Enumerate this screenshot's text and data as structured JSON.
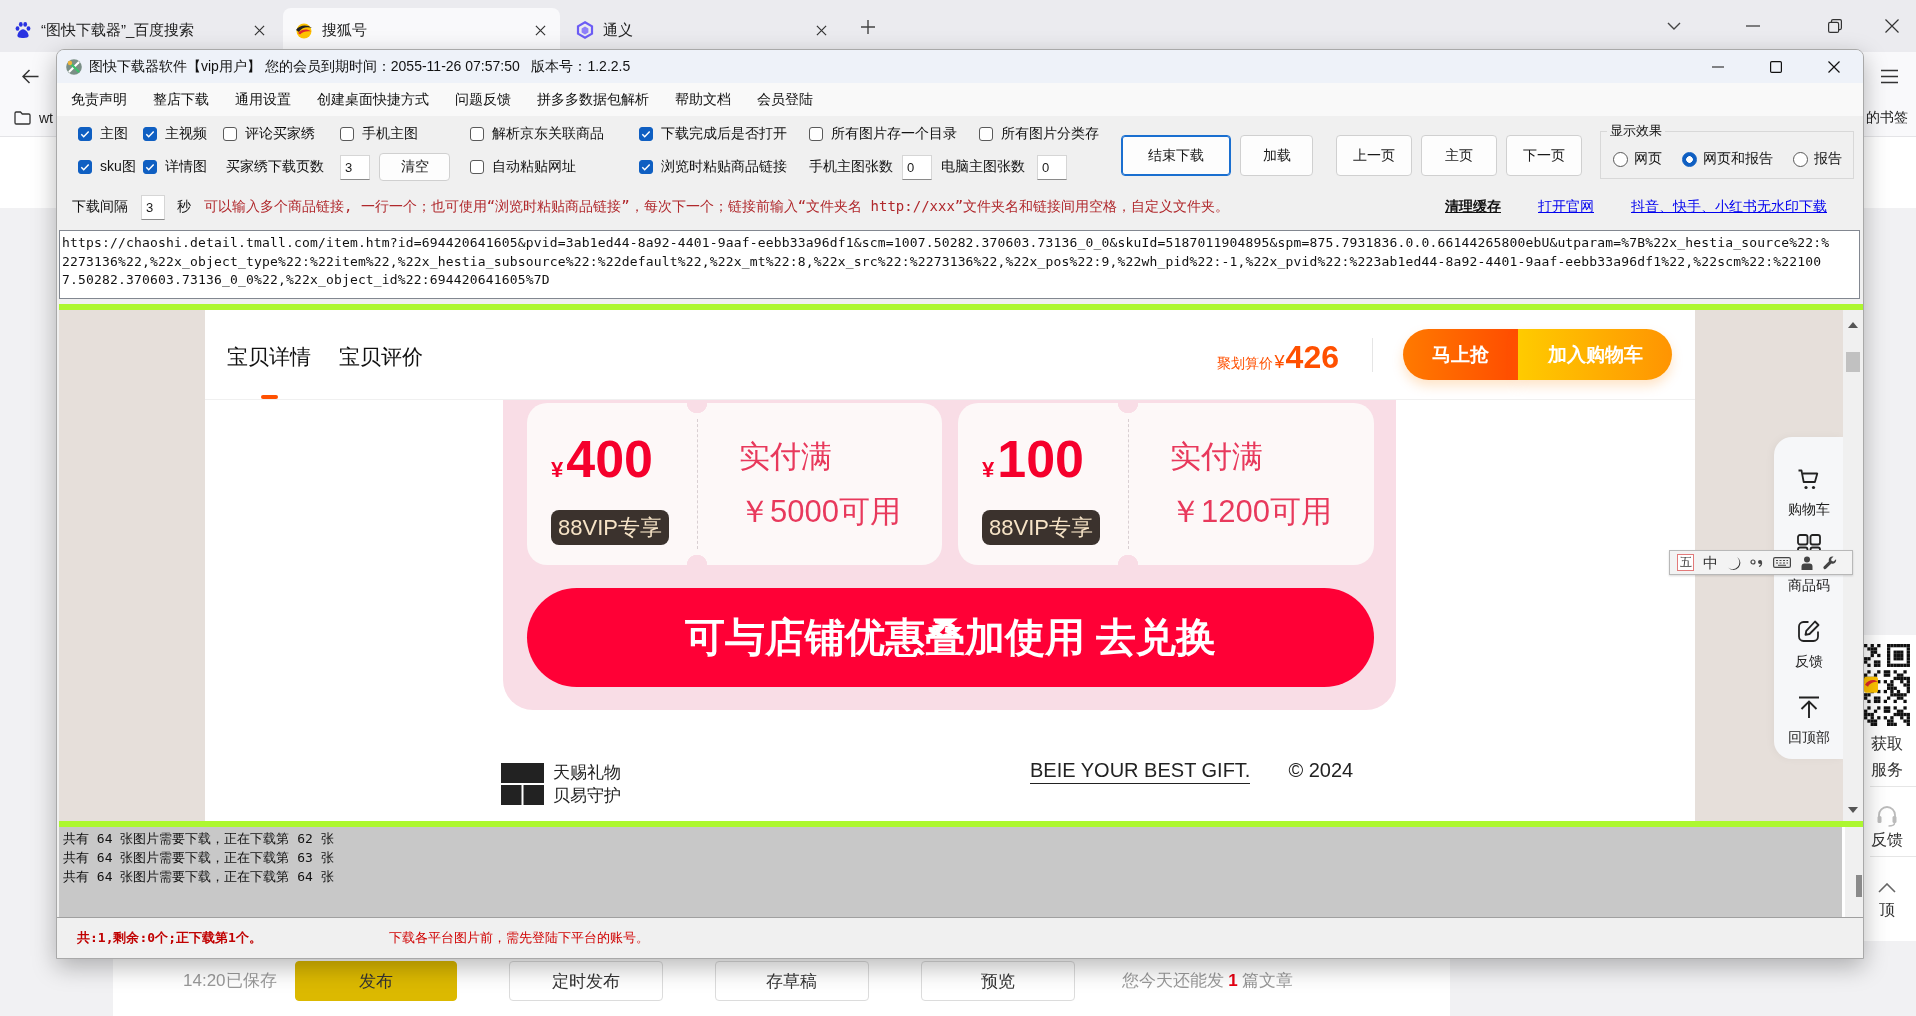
{
  "browser": {
    "tabs": [
      {
        "title": "“图快下载器”_百度搜索",
        "selected": false
      },
      {
        "title": "搜狐号",
        "selected": true
      },
      {
        "title": "通义",
        "selected": false
      }
    ],
    "bookmarks": {
      "left": "wt",
      "right": "的书签"
    }
  },
  "page_behind": {
    "side_panel": {
      "qr_caption": [
        "获取",
        "服务"
      ],
      "items": [
        {
          "label": "反馈"
        },
        {
          "label": "顶"
        }
      ]
    },
    "editor_bar": {
      "save_status": "14:20已保存",
      "buttons": [
        {
          "label": "发布",
          "kind": "primary"
        },
        {
          "label": "定时发布",
          "kind": "default"
        },
        {
          "label": "存草稿",
          "kind": "default"
        },
        {
          "label": "预览",
          "kind": "default"
        }
      ],
      "quota": "您今天还能发 **1** 篇文章"
    }
  },
  "app": {
    "title": "图快下载器软件【vip用户】 您的会员到期时间：2055-11-26 07:57:50   版本号：1.2.2.5",
    "menu": [
      "免责声明",
      "整店下载",
      "通用设置",
      "创建桌面快捷方式",
      "问题反馈",
      "拼多多数据包解析",
      "帮助文档",
      "会员登陆"
    ],
    "options": {
      "rows": [
        [
          {
            "kind": "checkbox",
            "label": "主图",
            "checked": true
          },
          {
            "kind": "checkbox",
            "label": "主视频",
            "checked": true
          },
          {
            "kind": "checkbox",
            "label": "评论买家绣",
            "checked": false
          },
          {
            "kind": "checkbox",
            "label": "手机主图",
            "checked": false
          },
          {
            "kind": "checkbox",
            "label": "解析京东关联商品",
            "checked": false
          },
          {
            "kind": "checkbox",
            "label": "下载完成后是否打开",
            "checked": true
          },
          {
            "kind": "checkbox",
            "label": "所有图片存一个目录",
            "checked": false
          },
          {
            "kind": "checkbox",
            "label": "所有图片分类存",
            "checked": false
          }
        ],
        [
          {
            "kind": "checkbox",
            "label": "sku图",
            "checked": true
          },
          {
            "kind": "checkbox",
            "label": "详情图",
            "checked": true
          },
          {
            "kind": "number",
            "label": "买家绣下载页数",
            "value": "3"
          },
          {
            "kind": "button",
            "label": "清空"
          },
          {
            "kind": "checkbox",
            "label": "自动粘贴网址",
            "checked": false
          },
          {
            "kind": "checkbox",
            "label": "浏览时粘贴商品链接",
            "checked": true
          },
          {
            "kind": "number",
            "label": "手机主图张数",
            "value": "0"
          },
          {
            "kind": "number",
            "label": "电脑主图张数",
            "value": "0"
          }
        ]
      ],
      "action_buttons": [
        {
          "label": "结束下载",
          "focused": true
        },
        {
          "label": "加载",
          "focused": false
        }
      ],
      "nav_buttons": [
        {
          "label": "上一页"
        },
        {
          "label": "主页"
        },
        {
          "label": "下一页"
        }
      ],
      "display": {
        "title": "显示效果",
        "options": [
          {
            "label": "网页",
            "selected": false
          },
          {
            "label": "网页和报告",
            "selected": true
          },
          {
            "label": "报告",
            "selected": false
          }
        ]
      }
    },
    "settings_row": {
      "interval_label": "下载间隔",
      "interval_value": "3",
      "interval_unit": "秒",
      "hint": "可以输入多个商品链接, 一行一个；也可使用“浏览时粘贴商品链接”，每次下一个；链接前输入“文件夹名 http://xxx”文件夹名和链接间用空格，自定义文件夹。",
      "links": [
        {
          "label": "清理缓存",
          "kind": "action"
        },
        {
          "label": "打开官网",
          "kind": "link"
        },
        {
          "label": "抖音、快手、小红书无水印下载",
          "kind": "link"
        }
      ]
    },
    "url_field": {
      "value": "https://chaoshi.detail.tmall.com/item.htm?id=694420641605&pvid=3ab1ed44-8a92-4401-9aaf-eebb33a96df1&scm=1007.50282.370603.73136_0_0&skuId=5187011904895&spm=875.7931836.0.0.66144265800ebU&utparam=%7B%22x_hestia_source%22:%2273136%22,%22x_object_type%22:%22item%22,%22x_hestia_subsource%22:%22default%22,%22x_mt%22:8,%22x_src%22:%2273136%22,%22x_pos%22:9,%22wh_pid%22:-1,%22x_pvid%22:%223ab1ed44-8a92-4401-9aaf-eebb33a96df1%22,%22scm%22:%221007.50282.370603.73136_0_0%22,%22x_object_id%22:694420641605%7D"
    },
    "webpage": {
      "tabs": [
        {
          "label": "宝贝详情",
          "selected": true
        },
        {
          "label": "宝贝评价",
          "selected": false
        }
      ],
      "price_label": "聚划算价",
      "price_currency": "¥",
      "price_value": "426",
      "buy_buttons": [
        {
          "label": "马上抢"
        },
        {
          "label": "加入购物车"
        }
      ],
      "coupons": [
        {
          "currency": "¥",
          "amount": "400",
          "badge": "88VIP专享",
          "condition": "实付满",
          "threshold": "￥5000可用"
        },
        {
          "currency": "¥",
          "amount": "100",
          "badge": "88VIP专享",
          "condition": "实付满",
          "threshold": "￥1200可用"
        }
      ],
      "coupon_action": "可与店铺优惠叠加使用 去兑换",
      "footer": {
        "brand_lines": [
          "天赐礼物",
          "贝易守护"
        ],
        "slogan": "BEIE YOUR BEST GIFT.",
        "copyright": "© 2024"
      },
      "side_tools": [
        {
          "label": "购物车"
        },
        {
          "label": "商品码"
        },
        {
          "label": "反馈"
        },
        {
          "label": "回顶部"
        }
      ]
    },
    "ime_toolbar": {
      "mode": "五",
      "language": "中"
    },
    "log": {
      "lines": [
        "共有 64 张图片需要下载，正在下载第 62 张",
        "共有 64 张图片需要下载，正在下载第 63 张",
        "共有 64 张图片需要下载，正在下载第 64 张"
      ]
    },
    "status_bar": {
      "progress": "共:1,剩余:0个;正下载第1个。",
      "notice": "下载各平台图片前，需先登陆下平台的账号。"
    }
  }
}
